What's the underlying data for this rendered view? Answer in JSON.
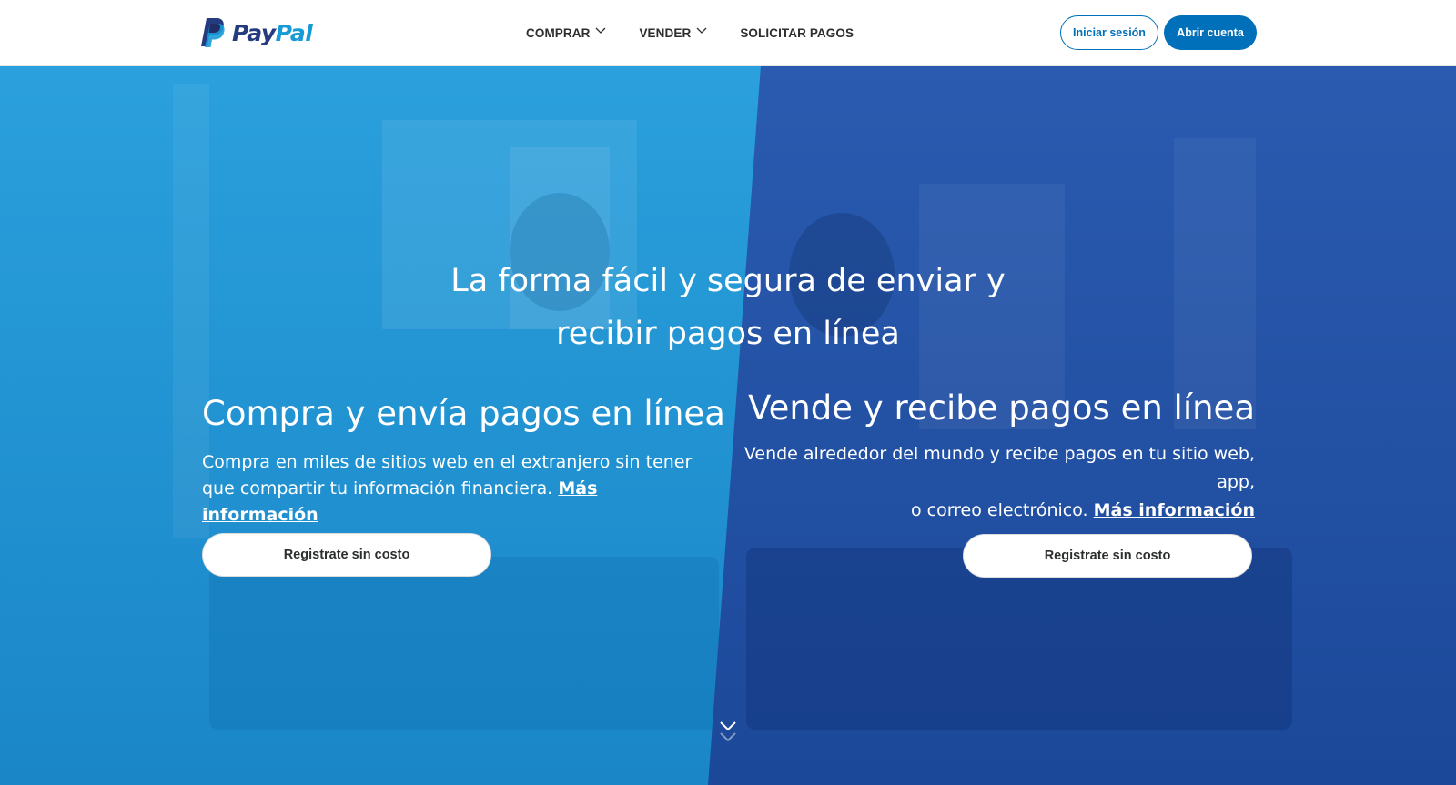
{
  "brand": {
    "name_part1": "Pay",
    "name_part2": "Pal",
    "colors": {
      "dark_blue": "#253b80",
      "light_blue": "#179bd7",
      "primary": "#0070ba"
    },
    "logo_icon": "paypal-p-icon"
  },
  "nav": {
    "items": [
      {
        "label": "COMPRAR",
        "has_dropdown": true,
        "icon": "chevron-down-icon"
      },
      {
        "label": "VENDER",
        "has_dropdown": true,
        "icon": "chevron-down-icon"
      },
      {
        "label": "SOLICITAR PAGOS",
        "has_dropdown": false
      }
    ],
    "login_label": "Iniciar sesión",
    "signup_label": "Abrir cuenta"
  },
  "hero": {
    "headline_line1": "La forma fácil y segura de enviar y",
    "headline_line2": "recibir pagos en línea",
    "left_panel_color": "#1c8fd0",
    "right_panel_color": "#1f4fa3",
    "left": {
      "title": "Compra y envía pagos en línea",
      "description": "Compra en miles de sitios web en el extranjero sin tener que compartir tu información financiera.",
      "link_label": "Más información",
      "cta_label": "Registrate sin costo"
    },
    "right": {
      "title": "Vende y recibe pagos en línea",
      "description_line1": "Vende alrededor del mundo y recibe pagos en tu sitio web, app,",
      "description_line2": "o correo electrónico.",
      "link_label": "Más información",
      "cta_label": "Registrate sin costo"
    },
    "scroll_icon": "chevron-down-double-icon"
  }
}
